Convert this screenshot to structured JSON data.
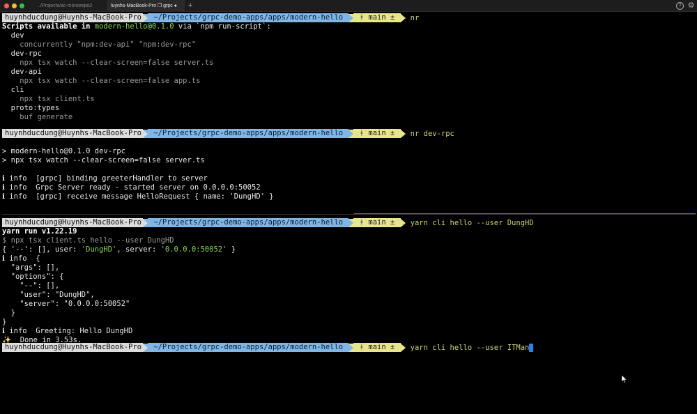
{
  "titlebar": {
    "tab1": "../Projects/ac-monorepo2",
    "tab2": "luynhs-MacBook-Pro ❐ grpc ●",
    "add_tab": "+"
  },
  "prompt": {
    "user": "huynhducdung@Huynhs-MacBook-Pro",
    "path": " ~/Projects/grpc-demo-apps/apps/modern-hello ",
    "git": " ᚼ main ± "
  },
  "block1": {
    "cmd": "nr",
    "scripts_prefix": "Scripts available in ",
    "scripts_pkg": "modern-hello@0.1.0",
    "scripts_suffix": " via `npm run-script`:",
    "lines": [
      "  dev",
      "    concurrently \"npm:dev-api\" \"npm:dev-rpc\"",
      "  dev-rpc",
      "    npx tsx watch --clear-screen=false server.ts",
      "  dev-api",
      "    npx tsx watch --clear-screen=false app.ts",
      "  cli",
      "    npx tsx client.ts",
      "  proto:types",
      "    buf generate"
    ]
  },
  "block2": {
    "cmd": "nr dev-rpc",
    "lines": [
      "> modern-hello@0.1.0 dev-rpc",
      "> npx tsx watch --clear-screen=false server.ts",
      "",
      "ℹ info  [grpc] binding greeterHandler to server",
      "ℹ info  Grpc Server ready - started server on 0.0.0.0:50052",
      "ℹ info  [grpc] receive message HelloRequest { name: 'DungHD' }"
    ]
  },
  "block3": {
    "cmd": "yarn cli hello --user DungHD",
    "yarn_version": "yarn run v1.22.19",
    "npx_line": "$ npx tsx client.ts hello --user DungHD",
    "obj_open": "{ '--': [], user: ",
    "obj_user": "'DungHD'",
    "obj_mid": ", server: ",
    "obj_server": "'0.0.0.0:50052'",
    "obj_close": " }",
    "lines": [
      "ℹ info  {",
      "  \"args\": [],",
      "  \"options\": {",
      "    \"--\": [],",
      "    \"user\": \"DungHD\",",
      "    \"server\": \"0.0.0.0:50052\"",
      "  }",
      "}",
      "ℹ info  Greeting: Hello DungHD",
      "✨  Done in 3.53s."
    ]
  },
  "block4": {
    "cmd": "yarn cli hello --user ITMan"
  }
}
